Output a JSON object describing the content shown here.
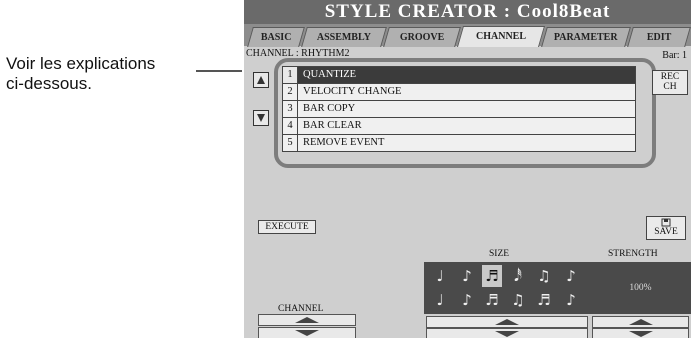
{
  "callout": {
    "line1": "Voir les explications",
    "line2": "ci-dessous."
  },
  "screen": {
    "title": "STYLE CREATOR : Cool8Beat",
    "tabs": [
      {
        "label": "BASIC"
      },
      {
        "label": "ASSEMBLY"
      },
      {
        "label": "GROOVE"
      },
      {
        "label": "CHANNEL"
      },
      {
        "label": "PARAMETER"
      },
      {
        "label": "EDIT"
      }
    ],
    "active_tab": "CHANNEL",
    "channel_label": "CHANNEL : RHYTHM2",
    "bar_label": "Bar:  1",
    "menu": [
      {
        "num": "1",
        "label": "QUANTIZE"
      },
      {
        "num": "2",
        "label": "VELOCITY CHANGE"
      },
      {
        "num": "3",
        "label": "BAR COPY"
      },
      {
        "num": "4",
        "label": "BAR CLEAR"
      },
      {
        "num": "5",
        "label": "REMOVE EVENT"
      }
    ],
    "selected_menu_index": 0,
    "rec_ch_line1": "REC",
    "rec_ch_line2": "CH",
    "execute_label": "EXECUTE",
    "save_label": "SAVE",
    "size_label": "SIZE",
    "strength_label": "STRENGTH",
    "strength_value": "100%",
    "channel_panel_label": "CHANNEL",
    "note_icons": [
      "quarter-note-icon",
      "eighth-note-icon",
      "sixteenth-note-icon",
      "thirty-second-note-icon",
      "sixteenth-swing-icon",
      "eighth-c-icon",
      "quarter-triplet-icon",
      "eighth-triplet-icon",
      "sixteenth-triplet-icon",
      "eighth-swing-triplet-icon",
      "sixteenth-swing-triplet-icon",
      "sixteenth-c-icon"
    ],
    "selected_note_index": 2
  }
}
